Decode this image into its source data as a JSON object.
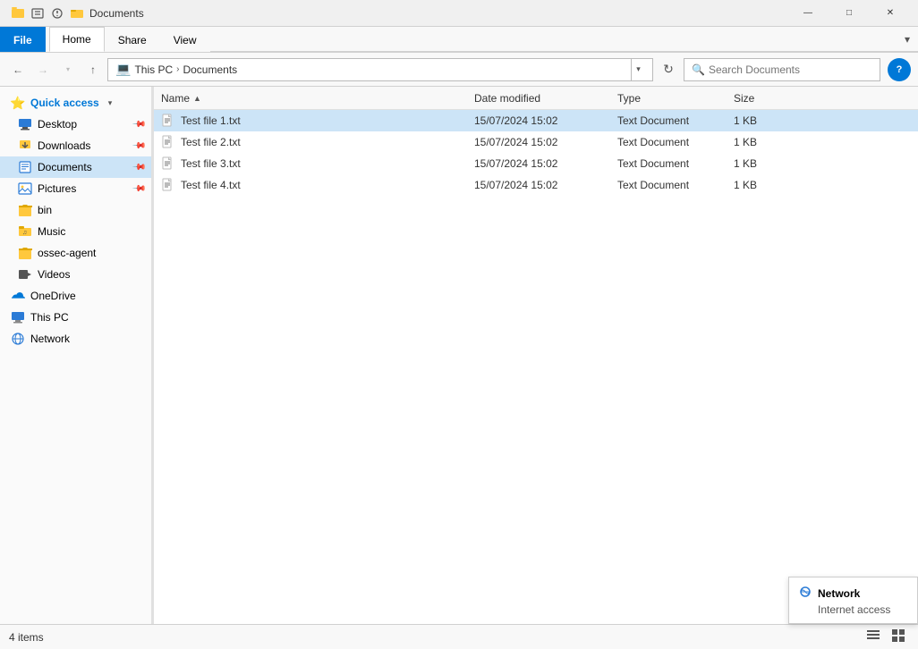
{
  "window": {
    "title": "Documents",
    "title_icon": "📁"
  },
  "title_bar": {
    "quick_access_icon": "⚡",
    "folder_icon": "📁",
    "title": "Documents",
    "minimize": "—",
    "maximize": "□",
    "close": "✕"
  },
  "ribbon": {
    "tabs": [
      {
        "id": "file",
        "label": "File",
        "active": false,
        "file_tab": true
      },
      {
        "id": "home",
        "label": "Home",
        "active": true,
        "file_tab": false
      },
      {
        "id": "share",
        "label": "Share",
        "active": false,
        "file_tab": false
      },
      {
        "id": "view",
        "label": "View",
        "active": false,
        "file_tab": false
      }
    ]
  },
  "address_bar": {
    "back_disabled": false,
    "forward_disabled": true,
    "up_label": "↑",
    "path_parts": [
      {
        "label": "This PC"
      },
      {
        "label": "Documents"
      }
    ],
    "search_placeholder": "Search Documents",
    "help_label": "?"
  },
  "sidebar": {
    "items": [
      {
        "id": "quick-access",
        "label": "Quick access",
        "icon": "⭐",
        "icon_class": "icon-quick",
        "is_header": true,
        "expanded": true
      },
      {
        "id": "desktop",
        "label": "Desktop",
        "icon": "🖥",
        "icon_class": "icon-desktop",
        "pinned": true
      },
      {
        "id": "downloads",
        "label": "Downloads",
        "icon": "↓",
        "icon_class": "icon-downloads",
        "pinned": true
      },
      {
        "id": "documents",
        "label": "Documents",
        "icon": "📄",
        "icon_class": "icon-documents",
        "pinned": true,
        "active": true
      },
      {
        "id": "pictures",
        "label": "Pictures",
        "icon": "🖼",
        "icon_class": "icon-pictures",
        "pinned": true
      },
      {
        "id": "bin",
        "label": "bin",
        "icon": "📁",
        "icon_class": "icon-folder"
      },
      {
        "id": "music",
        "label": "Music",
        "icon": "🎵",
        "icon_class": "icon-music"
      },
      {
        "id": "ossec-agent",
        "label": "ossec-agent",
        "icon": "📁",
        "icon_class": "icon-folder"
      },
      {
        "id": "videos",
        "label": "Videos",
        "icon": "🎬",
        "icon_class": "icon-videos"
      },
      {
        "id": "onedrive",
        "label": "OneDrive",
        "icon": "☁",
        "icon_class": "icon-onedrive"
      },
      {
        "id": "thispc",
        "label": "This PC",
        "icon": "💻",
        "icon_class": "icon-thispc"
      },
      {
        "id": "network",
        "label": "Network",
        "icon": "🌐",
        "icon_class": "icon-network"
      }
    ]
  },
  "column_headers": {
    "name": "Name",
    "date_modified": "Date modified",
    "type": "Type",
    "size": "Size"
  },
  "files": [
    {
      "name": "Test file 1.txt",
      "date_modified": "15/07/2024 15:02",
      "type": "Text Document",
      "size": "1 KB",
      "selected": true
    },
    {
      "name": "Test file 2.txt",
      "date_modified": "15/07/2024 15:02",
      "type": "Text Document",
      "size": "1 KB",
      "selected": false
    },
    {
      "name": "Test file 3.txt",
      "date_modified": "15/07/2024 15:02",
      "type": "Text Document",
      "size": "1 KB",
      "selected": false
    },
    {
      "name": "Test file 4.txt",
      "date_modified": "15/07/2024 15:02",
      "type": "Text Document",
      "size": "1 KB",
      "selected": false
    }
  ],
  "status_bar": {
    "count_label": "4 items"
  },
  "network_badge": {
    "line1": "Network",
    "line2": "Internet access"
  }
}
